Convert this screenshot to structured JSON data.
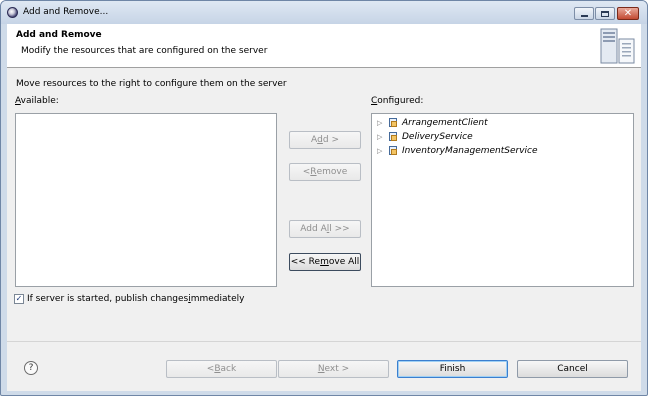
{
  "window": {
    "title": "Add and Remove..."
  },
  "header": {
    "title": "Add and Remove",
    "description": "Modify the resources that are configured on the server"
  },
  "main": {
    "message": "Move resources to the right to configure them on the server",
    "available_label_mnemonic": "A",
    "available_label_rest": "vailable:",
    "configured_label_mnemonic": "C",
    "configured_label_rest": "onfigured:",
    "available_items": [],
    "configured_items": [
      {
        "label": "ArrangementClient"
      },
      {
        "label": "DeliveryService"
      },
      {
        "label": "InventoryManagementService"
      }
    ]
  },
  "buttons": {
    "add_pre": "A",
    "add_mn": "d",
    "add_post": "d >",
    "remove_pre": "< ",
    "remove_mn": "R",
    "remove_post": "emove",
    "addall_pre": "Add A",
    "addall_mn": "l",
    "addall_post": "l >>",
    "removeall_pre": "<< Re",
    "removeall_mn": "m",
    "removeall_post": "ove All"
  },
  "options": {
    "publish_pre": "If server is started, publish changes ",
    "publish_mn": "i",
    "publish_post": "mmediately",
    "publish_checked": true
  },
  "footer": {
    "back_pre": "< ",
    "back_mn": "B",
    "back_post": "ack",
    "next_mn": "N",
    "next_post": "ext >",
    "finish": "Finish",
    "cancel": "Cancel",
    "help_symbol": "?"
  },
  "colors": {
    "title_bar": "#c6d4e6",
    "dialog_body": "#f0f0f0",
    "default_button_border": "#3b7fcf"
  }
}
